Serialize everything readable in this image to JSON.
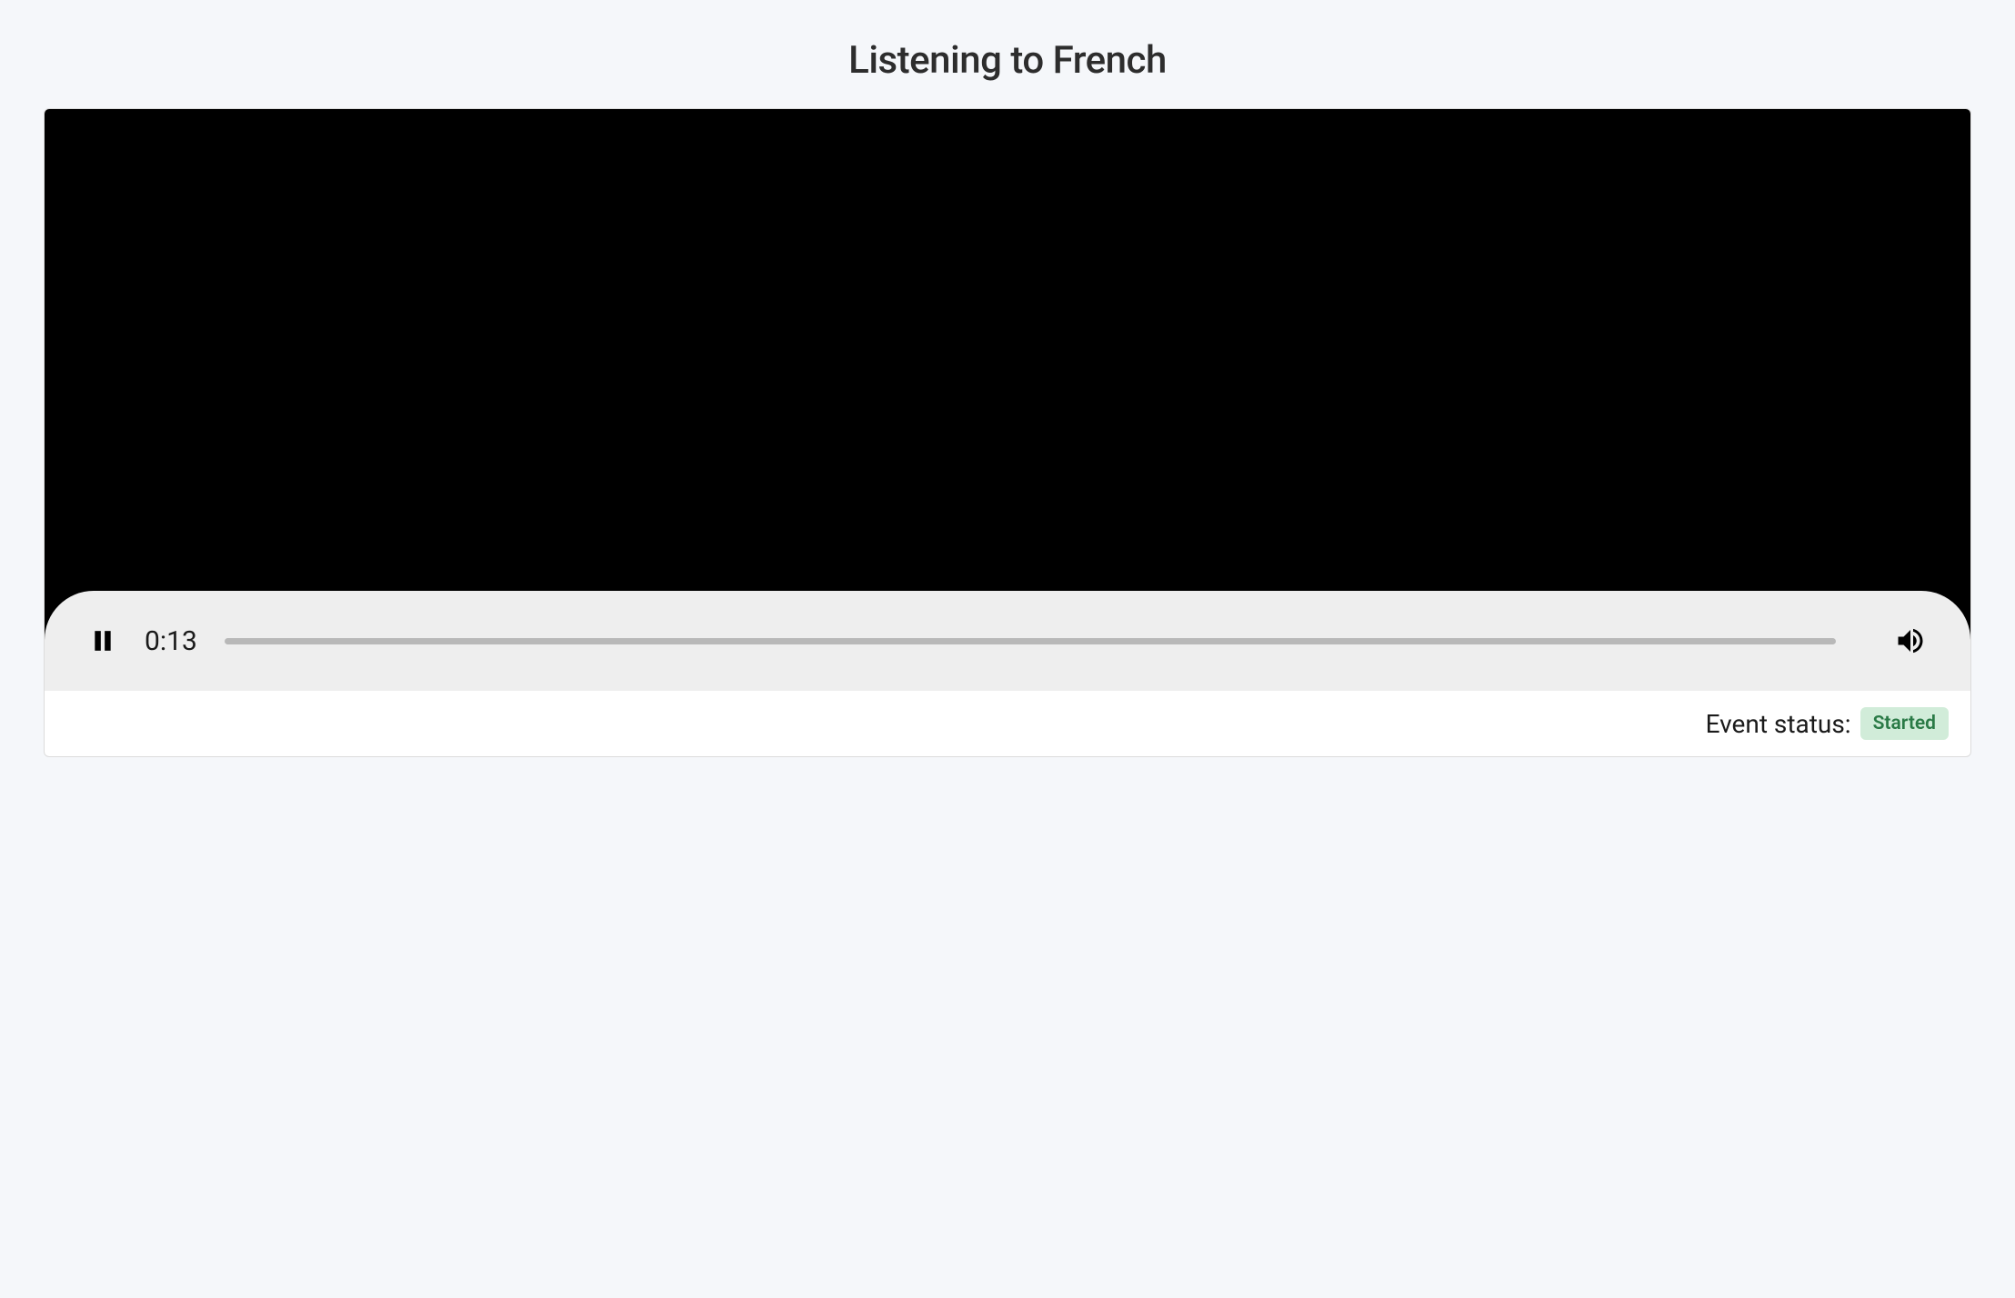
{
  "title": "Listening to French",
  "player": {
    "current_time": "0:13",
    "playing": true
  },
  "status": {
    "label": "Event status:",
    "value": "Started"
  }
}
